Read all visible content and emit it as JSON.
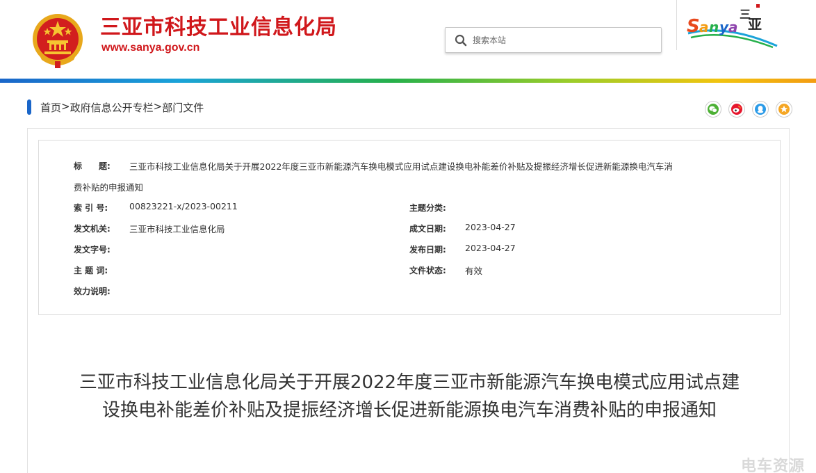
{
  "header": {
    "site_title": "三亚市科技工业信息化局",
    "site_url": "www.sanya.gov.cn",
    "search_placeholder": "搜索本站",
    "logo_text": "Sanya",
    "logo_subtext": "三亚"
  },
  "breadcrumb": {
    "items": [
      "首页",
      "政府信息公开专栏",
      "部门文件"
    ],
    "separator": ">"
  },
  "share": [
    "wechat-icon",
    "weibo-icon",
    "qq-icon",
    "favorite-icon"
  ],
  "meta": {
    "title_label": "标　　题:",
    "title_value_line1": "三亚市科技工业信息化局关于开展2022年度三亚市新能源汽车换电模式应用试点建设换电补能差价补贴及提振经济增长促进新能源换电汽车消",
    "title_value_line2": "费补贴的申报通知",
    "index_label": "索 引 号:",
    "index_value": "00823221-x/2023-00211",
    "category_label": "主题分类:",
    "category_value": "",
    "issuer_label": "发文机关:",
    "issuer_value": "三亚市科技工业信息化局",
    "created_label": "成文日期:",
    "created_value": "2023-04-27",
    "docno_label": "发文字号:",
    "docno_value": "",
    "published_label": "发布日期:",
    "published_value": "2023-04-27",
    "keywords_label": "主 题 词:",
    "keywords_value": "",
    "status_label": "文件状态:",
    "status_value": "有效",
    "validity_label": "效力说明:",
    "validity_value": ""
  },
  "document": {
    "title": "三亚市科技工业信息化局关于开展2022年度三亚市新能源汽车换电模式应用试点建设换电补能差价补贴及提振经济增长促进新能源换电汽车消费补贴的申报通知"
  },
  "watermark": "电车资源",
  "colors": {
    "brand_red": "#d0171b",
    "accent_blue": "#1a66c9"
  }
}
